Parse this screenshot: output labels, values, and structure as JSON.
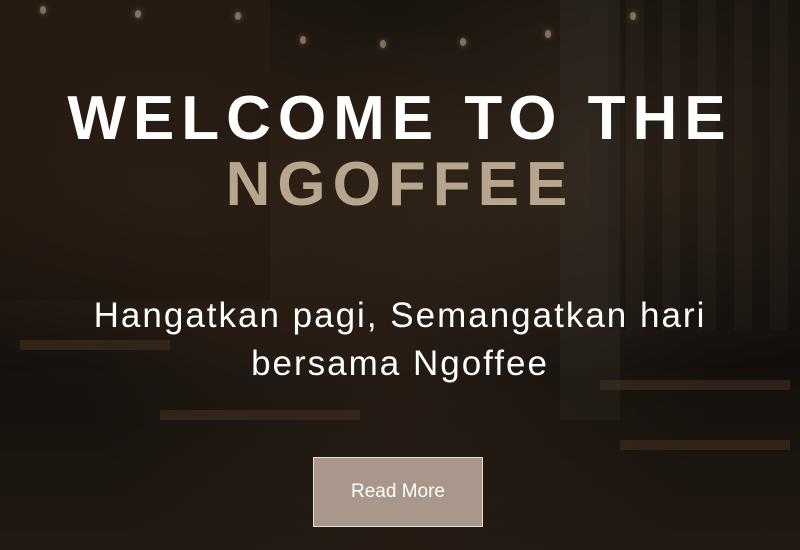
{
  "hero": {
    "title_line1": "WELCOME TO THE",
    "title_line2": "NGOFFEE",
    "tagline_line1": "Hangatkan pagi, Semangatkan hari",
    "tagline_line2": "bersama Ngoffee",
    "cta_label": "Read More"
  },
  "colors": {
    "title": "#ffffff",
    "brand_accent": "#b8a58f",
    "button_bg": "#a8978a"
  },
  "background": {
    "subject": "coffee-shop-interior-photo"
  }
}
